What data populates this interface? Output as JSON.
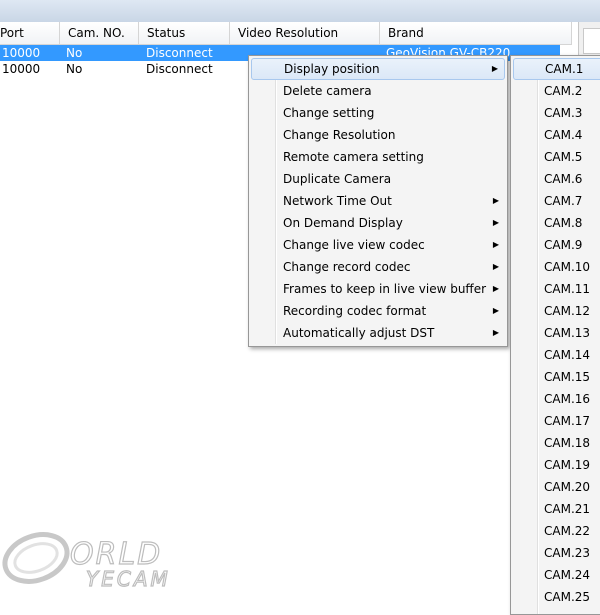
{
  "columns": [
    "Port",
    "Cam. NO.",
    "Status",
    "Video Resolution",
    "Brand"
  ],
  "rows": [
    {
      "port": "10000",
      "cam_no": "No",
      "status": "Disconnect",
      "video_resolution": "",
      "brand": "GeoVision  GV-CB220",
      "selected": true
    },
    {
      "port": "10000",
      "cam_no": "No",
      "status": "Disconnect",
      "video_resolution": "",
      "brand": "",
      "selected": false
    }
  ],
  "context_menu": {
    "items": [
      {
        "label": "Display position",
        "submenu": true
      },
      {
        "label": "Delete camera",
        "submenu": false
      },
      {
        "label": "Change setting",
        "submenu": false
      },
      {
        "label": "Change Resolution",
        "submenu": false
      },
      {
        "label": "Remote camera setting",
        "submenu": false
      },
      {
        "label": "Duplicate Camera",
        "submenu": false
      },
      {
        "label": "Network Time Out",
        "submenu": true
      },
      {
        "label": "On Demand Display",
        "submenu": true
      },
      {
        "label": "Change live view codec",
        "submenu": true
      },
      {
        "label": "Change record codec",
        "submenu": true
      },
      {
        "label": "Frames to keep in live view buffer",
        "submenu": true
      },
      {
        "label": "Recording codec format",
        "submenu": true
      },
      {
        "label": "Automatically adjust DST",
        "submenu": true
      }
    ],
    "arrow_glyph": "▶"
  },
  "submenu": {
    "items": [
      "CAM.1",
      "CAM.2",
      "CAM.3",
      "CAM.4",
      "CAM.5",
      "CAM.6",
      "CAM.7",
      "CAM.8",
      "CAM.9",
      "CAM.10",
      "CAM.11",
      "CAM.12",
      "CAM.13",
      "CAM.14",
      "CAM.15",
      "CAM.16",
      "CAM.17",
      "CAM.18",
      "CAM.19",
      "CAM.20",
      "CAM.21",
      "CAM.22",
      "CAM.23",
      "CAM.24",
      "CAM.25"
    ]
  },
  "watermark": {
    "text": "WORLDEYECAM"
  },
  "colors": {
    "selection": "#3399ff",
    "menu_bg": "#f4f4f4",
    "highlight_border": "#a8c8ee"
  }
}
